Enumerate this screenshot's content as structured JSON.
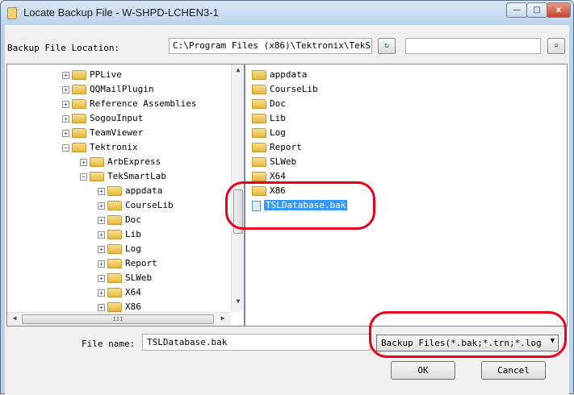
{
  "window": {
    "title": "Locate Backup File - W-SHPD-LCHEN3-1",
    "controls": {
      "minimize": "—",
      "maximize": "□",
      "close": "x"
    }
  },
  "location": {
    "label": "Backup File Location:",
    "value": "C:\\Program Files (x86)\\Tektronix\\TekS",
    "refresh_icon": "refresh-icon",
    "search_icon": "search-icon"
  },
  "tree": {
    "items": [
      {
        "label": "PPLive",
        "exp": "+"
      },
      {
        "label": "QQMailPlugin",
        "exp": "+"
      },
      {
        "label": "Reference Assemblies",
        "exp": "+"
      },
      {
        "label": "SogouInput",
        "exp": "+"
      },
      {
        "label": "TeamViewer",
        "exp": "+"
      },
      {
        "label": "Tektronix",
        "exp": "−"
      },
      {
        "label": "ArbExpress",
        "exp": "+"
      },
      {
        "label": "TekSmartLab",
        "exp": "−"
      },
      {
        "label": "appdata",
        "exp": "+"
      },
      {
        "label": "CourseLib",
        "exp": "+"
      },
      {
        "label": "Doc",
        "exp": "+"
      },
      {
        "label": "Lib",
        "exp": "+"
      },
      {
        "label": "Log",
        "exp": "+"
      },
      {
        "label": "Report",
        "exp": "+"
      },
      {
        "label": "SLWeb",
        "exp": "+"
      },
      {
        "label": "X64",
        "exp": "+"
      },
      {
        "label": "X86",
        "exp": "+"
      }
    ],
    "hscroll_thumb": "III"
  },
  "files": {
    "items": [
      {
        "label": "appdata",
        "type": "folder"
      },
      {
        "label": "CourseLib",
        "type": "folder"
      },
      {
        "label": "Doc",
        "type": "folder"
      },
      {
        "label": "Lib",
        "type": "folder"
      },
      {
        "label": "Log",
        "type": "folder"
      },
      {
        "label": "Report",
        "type": "folder"
      },
      {
        "label": "SLWeb",
        "type": "folder"
      },
      {
        "label": "X64",
        "type": "folder"
      },
      {
        "label": "X86",
        "type": "folder"
      },
      {
        "label": "TSLDatabase.bak",
        "type": "file",
        "selected": true
      }
    ]
  },
  "filename": {
    "label": "File name:",
    "value": "TSLDatabase.bak"
  },
  "filetype": {
    "selected": "Backup Files(*.bak;*.trn;*.log"
  },
  "buttons": {
    "ok": "OK",
    "cancel": "Cancel"
  },
  "colors": {
    "highlight": "#e8001c",
    "selection": "#3399ff"
  }
}
